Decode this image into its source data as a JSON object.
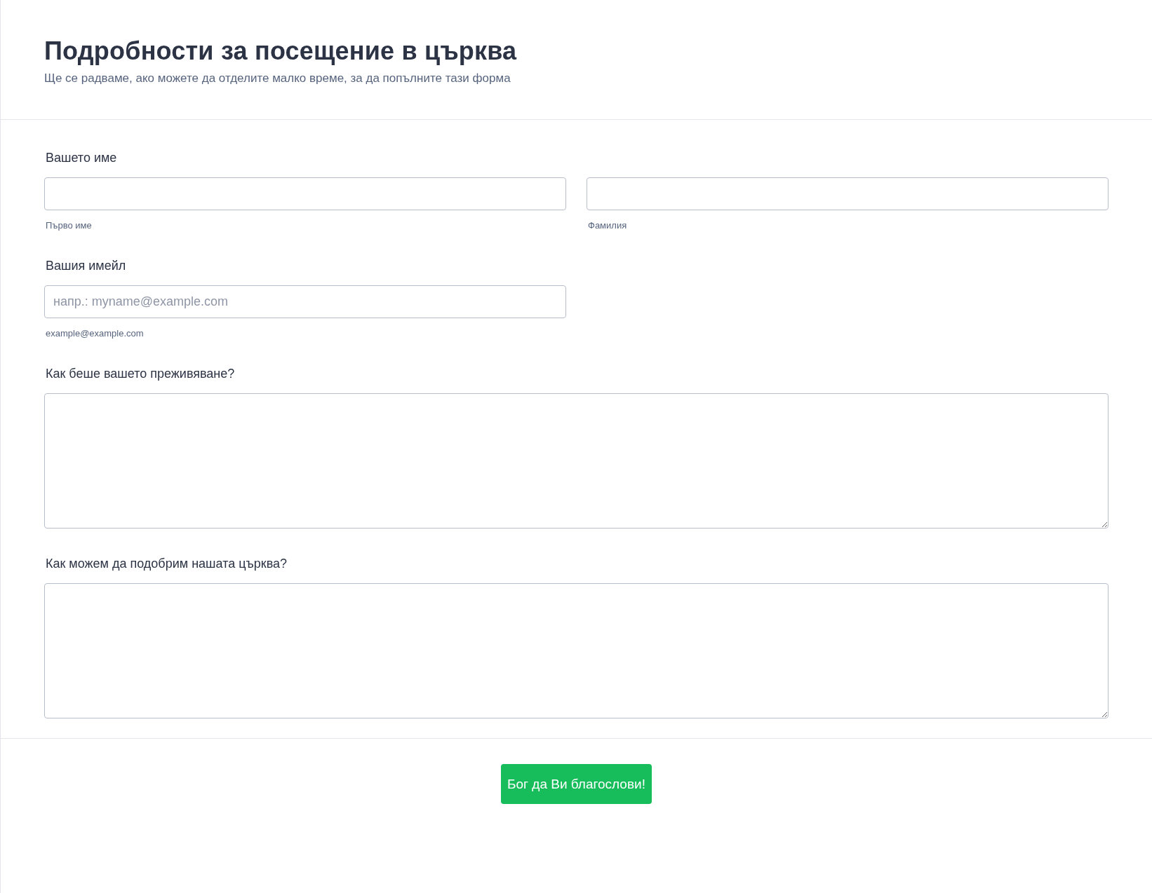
{
  "header": {
    "title": "Подробности за посещение в църква",
    "subtitle": "Ще се радваме, ако можете да отделите малко време, за да попълните тази форма"
  },
  "fields": [
    {
      "kind": "name",
      "label": "Вашето име",
      "parts": [
        {
          "sublabel": "Първо име"
        },
        {
          "sublabel": "Фамилия"
        }
      ]
    },
    {
      "kind": "email",
      "label": "Вашия имейл",
      "placeholder": "напр.: myname@example.com",
      "sublabel": "example@example.com"
    },
    {
      "kind": "textarea",
      "label": "Как беше вашето преживяване?"
    },
    {
      "kind": "textarea",
      "label": "Как можем да подобрим нашата църква?"
    }
  ],
  "submit": {
    "label": "Бог да Ви благослови!"
  }
}
